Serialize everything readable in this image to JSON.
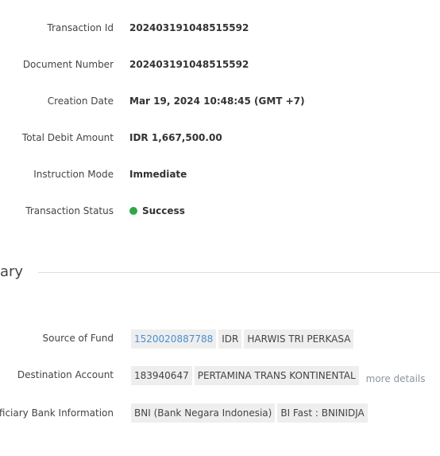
{
  "details": {
    "transaction_id_label": "Transaction Id",
    "transaction_id": "202403191048515592",
    "document_number_label": "Document Number",
    "document_number": "202403191048515592",
    "creation_date_label": "Creation Date",
    "creation_date": "Mar 19, 2024 10:48:45 (GMT +7)",
    "total_debit_label": "Total Debit Amount",
    "total_debit": "IDR 1,667,500.00",
    "instruction_mode_label": "Instruction Mode",
    "instruction_mode": "Immediate",
    "status_label": "Transaction Status",
    "status": "Success",
    "status_color": "#2ea84a"
  },
  "summary": {
    "section_title": "ary",
    "source_label": "Source of Fund",
    "source_account": "1520020887788",
    "source_currency": "IDR",
    "source_name": "HARWIS TRI PERKASA",
    "destination_label": "Destination Account",
    "destination_account": "183940647",
    "destination_name": "PERTAMINA TRANS KONTINENTAL",
    "more_details": "more details",
    "bank_label": "eficiary Bank Information",
    "bank_name": "BNI (Bank Negara Indonesia)",
    "bank_code": "BI Fast : BNINIDJA"
  },
  "colors": {
    "link": "#4a8fd0",
    "chip_background": "#eeeeee",
    "muted": "#8b95a0"
  }
}
